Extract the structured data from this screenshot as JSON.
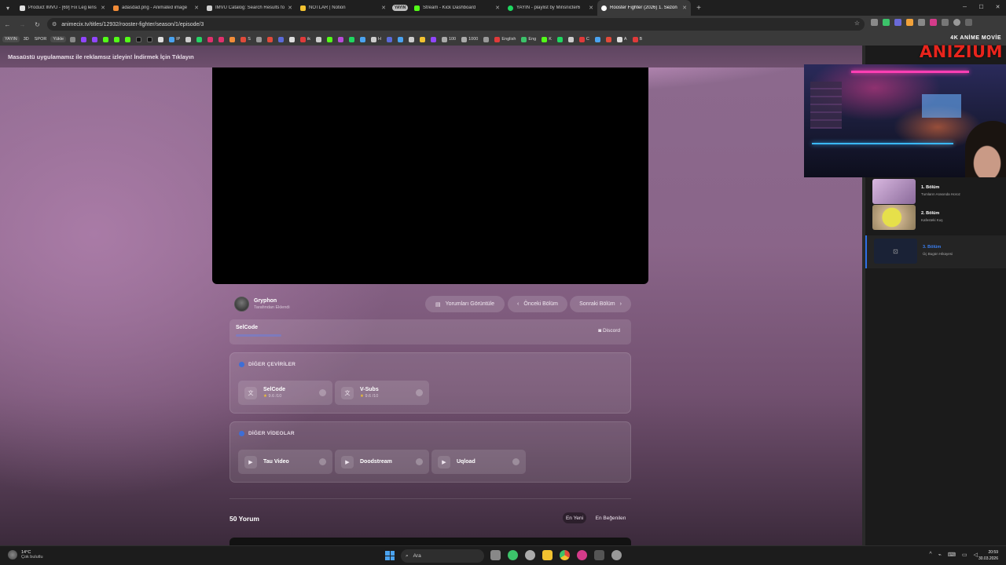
{
  "browser": {
    "tabs": [
      {
        "title": "Product IMVU - [69] Fix Leg lens",
        "color": "#e0e0e0",
        "active": false
      },
      {
        "title": "adasdad.png - Animated image",
        "color": "#f28c38",
        "active": false
      },
      {
        "title": "IMVU Catalog: Search Results fo",
        "color": "#d0d0d0",
        "active": false
      },
      {
        "title": "NOTLAR | Notion",
        "color": "#f2c230",
        "active": false
      },
      {
        "title": "Stream - Kick Dashboard",
        "color": "#53fc18",
        "active": false
      },
      {
        "title": "YAYIN - playlist by Minsnicter6",
        "color": "#1ed760",
        "active": false
      },
      {
        "title": "Rooster Fighter (2026) 1. Sezon",
        "color": "#ffffff",
        "active": true
      }
    ],
    "tab_group_label": "YAYIN",
    "url": "animecix.tv/titles/12932/rooster-fighter/season/1/episode/3",
    "bookmarks": [
      "YAYIN",
      "3D",
      "SPOR",
      "Yükle",
      "IP",
      "S",
      "ik",
      "H",
      "100",
      "1000",
      "English",
      "Eng",
      "K",
      "C",
      "A",
      "B"
    ]
  },
  "page": {
    "ad_text": "Masaüstü uygulamamız ile reklamsız izleyin! İndirmek İçin Tıklayın",
    "uploader": {
      "name": "Gryphon",
      "subtitle": "Tarafından Eklendi"
    },
    "actions": {
      "comments": "Yorumları Görüntüle",
      "prev": "Önceki Bölüm",
      "next": "Sonraki Bölüm"
    },
    "fansub": {
      "name": "SelCode",
      "discord": "Discord"
    },
    "translations": {
      "title": "DİĞER ÇEVİRİLER",
      "items": [
        {
          "name": "SelCode",
          "rating": "9.6",
          "suffix": "/10"
        },
        {
          "name": "V-Subs",
          "rating": "9.6",
          "suffix": "/10"
        }
      ]
    },
    "videos": {
      "title": "DİĞER VİDEOLAR",
      "items": [
        {
          "name": "Tau Video"
        },
        {
          "name": "Doodstream"
        },
        {
          "name": "Uqload"
        }
      ]
    },
    "comments": {
      "title": "50 Yorum",
      "sort_new": "En Yeni",
      "sort_liked": "En Beğenilen"
    }
  },
  "episodes": [
    {
      "title": "1. Bölüm",
      "subtitle": "Tumların Arasında Horoz",
      "current": false
    },
    {
      "title": "2. Bölüm",
      "subtitle": "Kafesteki Kuş",
      "current": false
    },
    {
      "title": "3. Bölüm",
      "subtitle": "Üç Bugün Hikayesi",
      "current": true
    }
  ],
  "overlay": {
    "brand_sub": "4K ANİME MOVİE",
    "brand_main": "ANIZIUM"
  },
  "taskbar": {
    "weather_temp": "14°C",
    "weather_desc": "Çok bulutlu",
    "search_placeholder": "Ara",
    "time": "20:59",
    "date": "30.03.2026"
  }
}
